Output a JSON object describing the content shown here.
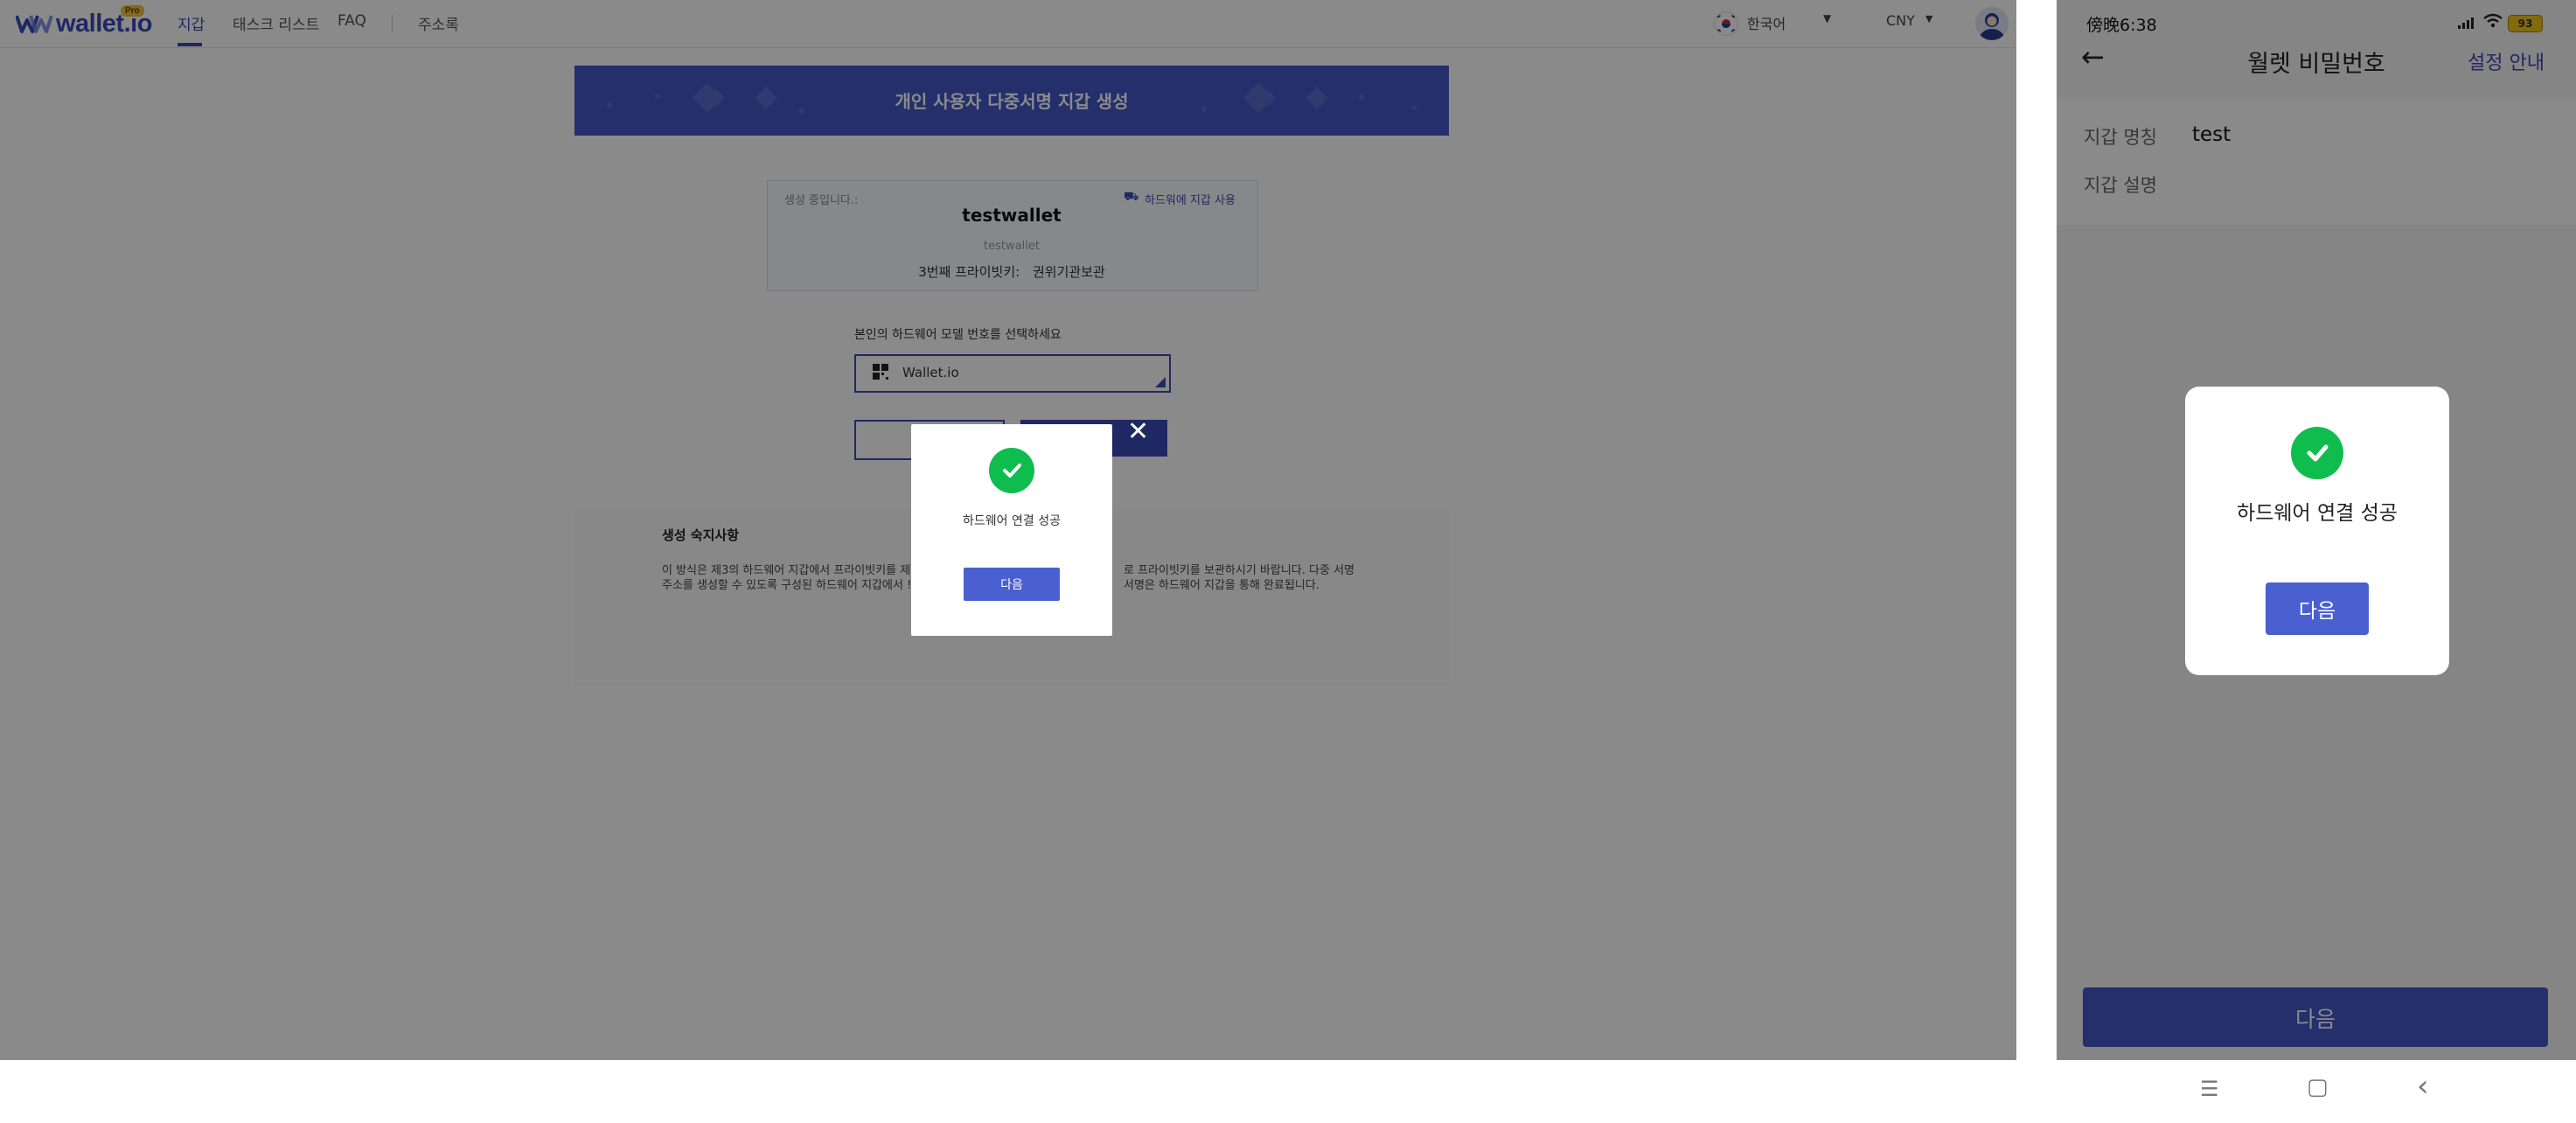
{
  "desktop": {
    "brand": {
      "name": "wallet.io",
      "badge": "Pro"
    },
    "nav": {
      "items": [
        "지갑",
        "태스크 리스트",
        "FAQ",
        "주소록"
      ]
    },
    "header_right": {
      "language": "한국어",
      "currency": "CNY"
    },
    "banner": {
      "title": "개인 사용자 다중서명 지갑 생성"
    },
    "info": {
      "creating_label": "생성 중입니다.:",
      "hardware_link": "하드워에 지갑 사용",
      "wallet_name": "testwallet",
      "wallet_desc": "testwallet",
      "key_label": "3번째 프라이빗키:",
      "key_value": "권위기관보관"
    },
    "select_prompt": "본인의 하드웨어 모델 번호를 선택하세요",
    "device_value": "Wallet.io",
    "guide": {
      "title": "생성 숙지사항",
      "line1_a": "이 방식은 제3의 하드웨어 지갑에서 프라이빗키를 제",
      "line1_b": "로 프라이빗키를 보관하시기 바랍니다. 다중 서명",
      "line2_a": "주소를 생성할 수 있도록 구성된 하드웨어 지갑에서 !",
      "line2_b": "서명은 하드웨어 지갑을 통해 완료됩니다."
    },
    "dialog": {
      "message": "하드웨어 연결 성공",
      "button": "다음",
      "close": "✕"
    }
  },
  "mobile": {
    "status": {
      "time": "傍晚6:38",
      "battery": "93"
    },
    "title": "월렛 비밀번호",
    "right_action": "설정 안내",
    "back": "←",
    "fields": [
      {
        "label": "지갑 명칭",
        "value": "test"
      },
      {
        "label": "지갑 설명",
        "value": ""
      }
    ],
    "dialog": {
      "message": "하드웨어 연결 성공",
      "button": "다음"
    },
    "bottom_button": "다음",
    "system_nav": {
      "menu": "☰",
      "home": "▢",
      "back": "‹"
    }
  }
}
